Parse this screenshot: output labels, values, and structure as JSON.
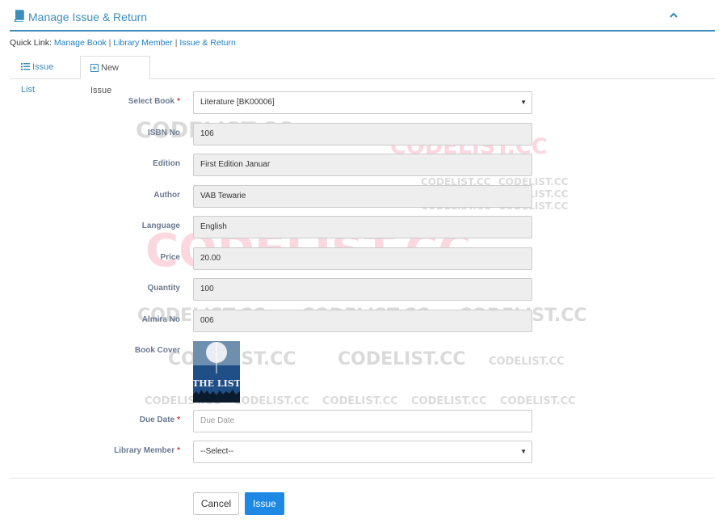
{
  "header": {
    "title": "Manage Issue & Return"
  },
  "quicklinks": {
    "prefix": "Quick Link:",
    "links": [
      "Manage Book",
      "Library Member",
      "Issue & Return"
    ],
    "separator": "|"
  },
  "tabs": [
    {
      "label": "Issue List",
      "active": false
    },
    {
      "label": "New Issue",
      "active": true
    }
  ],
  "form": {
    "select_book": {
      "label": "Select Book",
      "required_mark": "*",
      "value": "Literature [BK00006]"
    },
    "isbn": {
      "label": "ISBN No",
      "value": "106"
    },
    "edition": {
      "label": "Edition",
      "value": "First Edition Januar"
    },
    "author": {
      "label": "Author",
      "value": "VAB Tewarie"
    },
    "language": {
      "label": "Language",
      "value": "English"
    },
    "price": {
      "label": "Price",
      "value": "20.00"
    },
    "quantity": {
      "label": "Quantity",
      "value": "100"
    },
    "almira": {
      "label": "Almira No",
      "value": "006"
    },
    "book_cover": {
      "label": "Book Cover",
      "cover_title": "THE LIST"
    },
    "due_date": {
      "label": "Due Date",
      "required_mark": "*",
      "value": "",
      "placeholder": "Due Date"
    },
    "library_member": {
      "label": "Library Member",
      "required_mark": "*",
      "value": "--Select--"
    }
  },
  "buttons": {
    "cancel": "Cancel",
    "issue": "Issue"
  },
  "watermark": {
    "text": "CODELIST.CC"
  },
  "colors": {
    "accent": "#3c8dbc",
    "link": "#1e7fc2",
    "primary_button": "#1e88e5",
    "required": "#e0342a"
  }
}
